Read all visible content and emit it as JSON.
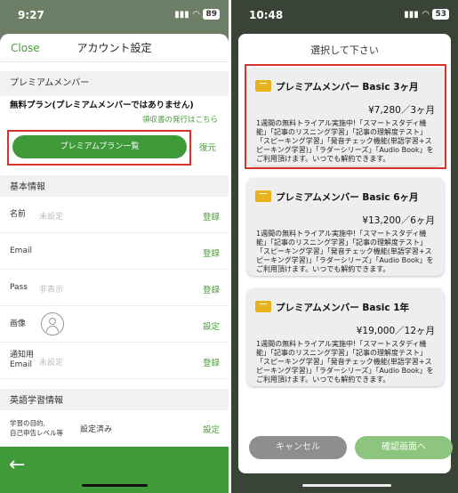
{
  "left": {
    "status": {
      "time": "9:27",
      "battery": "89"
    },
    "nav": {
      "close": "Close",
      "title": "アカウント設定"
    },
    "premium": {
      "section": "プレミアムメンバー",
      "status": "無料プラン(プレミアムメンバーではありません)",
      "receipt_link": "領収書の発行はこちら",
      "plan_button": "プレミアムプラン一覧",
      "restore": "復元"
    },
    "basic": {
      "section": "基本情報",
      "rows": [
        {
          "label": "名前",
          "value": "未設定",
          "action": "登録"
        },
        {
          "label": "Email",
          "value": "",
          "action": "登録"
        },
        {
          "label": "Pass",
          "value": "非表示",
          "action": "登録"
        },
        {
          "label": "画像",
          "value": "",
          "action": "設定"
        },
        {
          "label": "通知用\nEmail",
          "value": "未設定",
          "action": "登録"
        }
      ]
    },
    "english": {
      "section": "英語学習情報",
      "row": {
        "label": "学習の目的,\n自己申告レベル等",
        "value": "設定済み",
        "action": "設定"
      }
    },
    "back_glyph": "←"
  },
  "right": {
    "status": {
      "time": "10:48",
      "battery": "53"
    },
    "title": "選択して下さい",
    "plans": [
      {
        "name": "プレミアムメンバー Basic 3ヶ月",
        "price": "¥7,280／3ヶ月",
        "desc": "1週間の無料トライアル実施中!「スマートスタディ機能」「記事のリスニング学習」「記事の理解度テスト」「スピーキング学習」「発音チェック機能(単語学習+スピーキング学習)」「ラダーシリーズ」「Audio Book」をご利用頂けます。いつでも解約できます。"
      },
      {
        "name": "プレミアムメンバー Basic 6ヶ月",
        "price": "¥13,200／6ヶ月",
        "desc": "1週間の無料トライアル実施中!「スマートスタディ機能」「記事のリスニング学習」「記事の理解度テスト」「スピーキング学習」「発音チェック機能(単語学習+スピーキング学習)」「ラダーシリーズ」「Audio Book」をご利用頂けます。いつでも解約できます。"
      },
      {
        "name": "プレミアムメンバー Basic 1年",
        "price": "¥19,000／12ヶ月",
        "desc": "1週間の無料トライアル実施中!「スマートスタディ機能」「記事のリスニング学習」「記事の理解度テスト」「スピーキング学習」「発音チェック機能(単語学習+スピーキング学習)」「ラダーシリーズ」「Audio Book」をご利用頂けます。いつでも解約できます。"
      }
    ],
    "cancel": "キャンセル",
    "confirm": "確認画面へ"
  },
  "colors": {
    "accent": "#3f9a3a",
    "highlight": "#d9342c",
    "gem": "#e8b21a"
  }
}
